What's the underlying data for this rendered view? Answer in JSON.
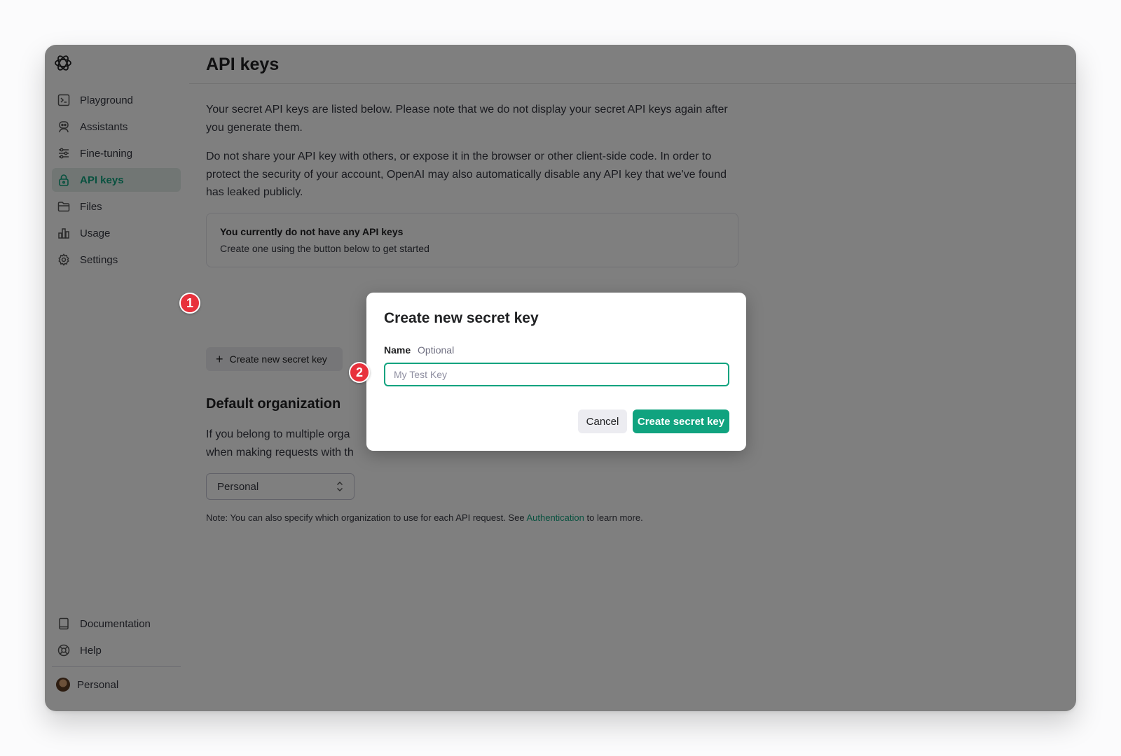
{
  "page": {
    "title": "API keys"
  },
  "sidebar": {
    "items": [
      {
        "label": "Playground",
        "icon": "terminal-icon"
      },
      {
        "label": "Assistants",
        "icon": "robot-icon"
      },
      {
        "label": "Fine-tuning",
        "icon": "sliders-icon"
      },
      {
        "label": "API keys",
        "icon": "lock-icon",
        "active": true
      },
      {
        "label": "Files",
        "icon": "folder-icon"
      },
      {
        "label": "Usage",
        "icon": "bar-chart-icon"
      },
      {
        "label": "Settings",
        "icon": "gear-icon"
      }
    ],
    "bottom": [
      {
        "label": "Documentation",
        "icon": "book-icon"
      },
      {
        "label": "Help",
        "icon": "lifebuoy-icon"
      }
    ],
    "user": "Personal"
  },
  "main": {
    "intro_1": "Your secret API keys are listed below. Please note that we do not display your secret API keys again after you generate them.",
    "intro_2": "Do not share your API key with others, or expose it in the browser or other client-side code. In order to protect the security of your account, OpenAI may also automatically disable any API key that we've found has leaked publicly.",
    "empty_title": "You currently do not have any API keys",
    "empty_sub": "Create one using the button below to get started",
    "create_button": "Create new secret key",
    "org_title": "Default organization",
    "org_para": "If you belong to multiple orga",
    "org_para_2": "when making requests with th",
    "org_select_value": "Personal",
    "note_prefix": "Note: You can also specify which organization to use for each API request. See ",
    "note_link": "Authentication",
    "note_suffix": " to learn more."
  },
  "modal": {
    "title": "Create new secret key",
    "name_label": "Name",
    "name_optional": "Optional",
    "name_placeholder": "My Test Key",
    "name_value": "",
    "cancel_label": "Cancel",
    "submit_label": "Create secret key"
  },
  "badges": {
    "step1": "1",
    "step2": "2"
  },
  "colors": {
    "accent": "#10a37f",
    "badge": "#e8313c",
    "overlay": "rgba(0,0,0,0.5)"
  }
}
